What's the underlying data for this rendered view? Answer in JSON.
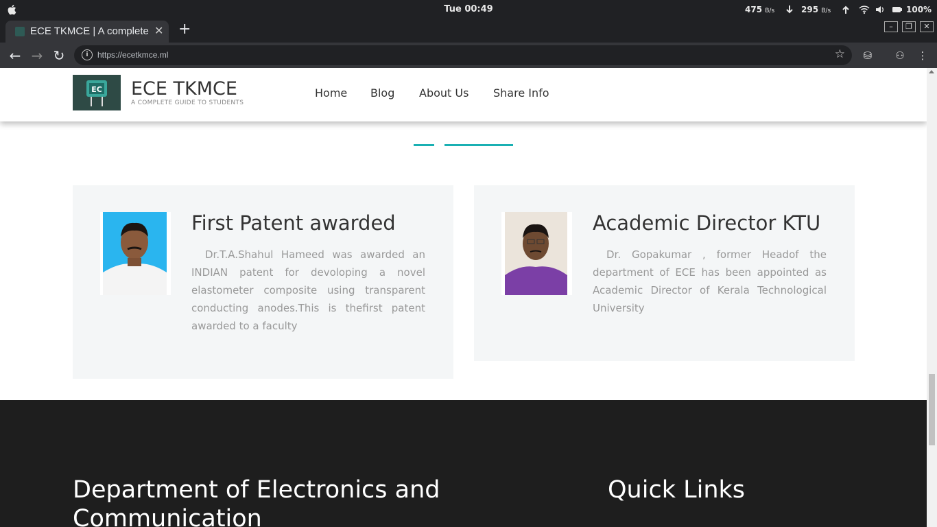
{
  "os_bar": {
    "clock": "Tue 00:49",
    "download_rate": "475",
    "download_unit": "B/s",
    "upload_rate": "295",
    "upload_unit": "B/s",
    "battery": "100%"
  },
  "browser": {
    "tab_title": "ECE TKMCE | A complete guide to students",
    "url": "https://ecetkmce.ml"
  },
  "site": {
    "logo_text": "EC",
    "brand": "ECE TKMCE",
    "tagline": "A COMPLETE GUIDE TO STUDENTS",
    "nav": [
      "Home",
      "Blog",
      "About Us",
      "Share Info"
    ]
  },
  "news": [
    {
      "title": "First Patent awarded",
      "body": "Dr.T.A.Shahul Hameed was awarded an INDIAN patent for devoloping a novel elastometer composite using transparent conducting anodes.This is thefirst patent awarded to a faculty"
    },
    {
      "title": "Academic Director KTU",
      "body": "Dr. Gopakumar , former Headof the department of ECE has been appointed as Academic Director of Kerala Technological University"
    }
  ],
  "footer": {
    "department": "Department of Electronics and Communication",
    "quick_links": "Quick Links"
  },
  "colors": {
    "accent": "#1ab0b3",
    "footer_bg": "#1e1e1e",
    "card_bg": "#f4f6f7"
  }
}
